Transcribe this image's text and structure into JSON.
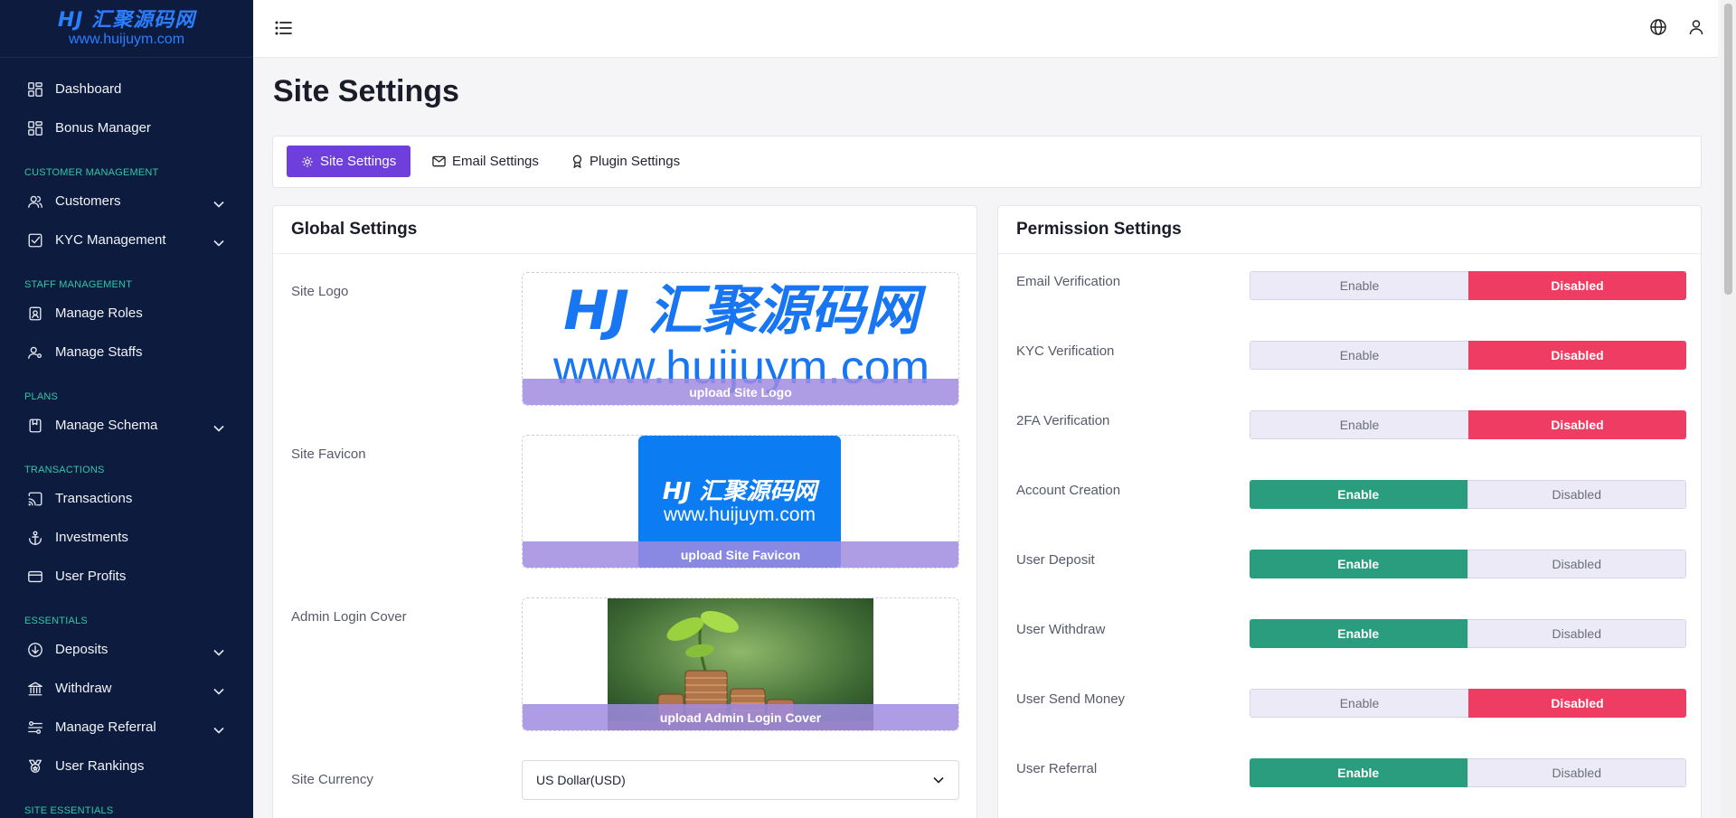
{
  "brand": {
    "line1": "HJ 汇聚源码网",
    "line2": "www.huijuym.com",
    "color": "#2b7fff"
  },
  "sidebar": {
    "background": "#0d1b3e",
    "section_color": "#2fc7a8",
    "items": [
      {
        "type": "item",
        "label": "Dashboard",
        "icon": "dashboard-icon"
      },
      {
        "type": "item",
        "label": "Bonus Manager",
        "icon": "grid-icon"
      },
      {
        "type": "section",
        "label": "CUSTOMER MANAGEMENT"
      },
      {
        "type": "item",
        "label": "Customers",
        "icon": "users-icon",
        "expandable": true
      },
      {
        "type": "item",
        "label": "KYC Management",
        "icon": "checkbox-icon",
        "expandable": true
      },
      {
        "type": "section",
        "label": "STAFF MANAGEMENT"
      },
      {
        "type": "item",
        "label": "Manage Roles",
        "icon": "badge-icon"
      },
      {
        "type": "item",
        "label": "Manage Staffs",
        "icon": "user-gear-icon"
      },
      {
        "type": "section",
        "label": "PLANS"
      },
      {
        "type": "item",
        "label": "Manage Schema",
        "icon": "bookmark-icon",
        "expandable": true
      },
      {
        "type": "section",
        "label": "TRANSACTIONS"
      },
      {
        "type": "item",
        "label": "Transactions",
        "icon": "cast-icon"
      },
      {
        "type": "item",
        "label": "Investments",
        "icon": "anchor-icon"
      },
      {
        "type": "item",
        "label": "User Profits",
        "icon": "card-icon"
      },
      {
        "type": "section",
        "label": "ESSENTIALS"
      },
      {
        "type": "item",
        "label": "Deposits",
        "icon": "arrow-down-circle-icon",
        "expandable": true
      },
      {
        "type": "item",
        "label": "Withdraw",
        "icon": "bank-icon",
        "expandable": true
      },
      {
        "type": "item",
        "label": "Manage Referral",
        "icon": "sliders-icon",
        "expandable": true
      },
      {
        "type": "item",
        "label": "User Rankings",
        "icon": "medal-icon"
      },
      {
        "type": "section",
        "label": "SITE ESSENTIALS"
      }
    ]
  },
  "page_title": "Site Settings",
  "tabs": [
    {
      "label": "Site Settings",
      "icon": "gear-icon",
      "active": true
    },
    {
      "label": "Email Settings",
      "icon": "mail-icon",
      "active": false
    },
    {
      "label": "Plugin Settings",
      "icon": "award-icon",
      "active": false
    }
  ],
  "global": {
    "title": "Global Settings",
    "site_logo_label": "Site Logo",
    "site_logo_upload": "upload Site Logo",
    "site_favicon_label": "Site Favicon",
    "site_favicon_upload": "upload Site Favicon",
    "admin_cover_label": "Admin Login Cover",
    "admin_cover_upload": "upload Admin Login Cover",
    "currency_label": "Site Currency",
    "currency_value": "US Dollar(USD)"
  },
  "permissions": {
    "title": "Permission Settings",
    "enable_label": "Enable",
    "disabled_label": "Disabled",
    "rows": [
      {
        "label": "Email Verification",
        "enabled": false
      },
      {
        "label": "KYC Verification",
        "enabled": false
      },
      {
        "label": "2FA Verification",
        "enabled": false
      },
      {
        "label": "Account Creation",
        "enabled": true
      },
      {
        "label": "User Deposit",
        "enabled": true
      },
      {
        "label": "User Withdraw",
        "enabled": true
      },
      {
        "label": "User Send Money",
        "enabled": false
      },
      {
        "label": "User Referral",
        "enabled": true
      }
    ]
  },
  "colors": {
    "accent": "#6f3fdb",
    "enable": "#2a9d7f",
    "disabled": "#ef3c63",
    "upload_band": "#a08ce1"
  }
}
